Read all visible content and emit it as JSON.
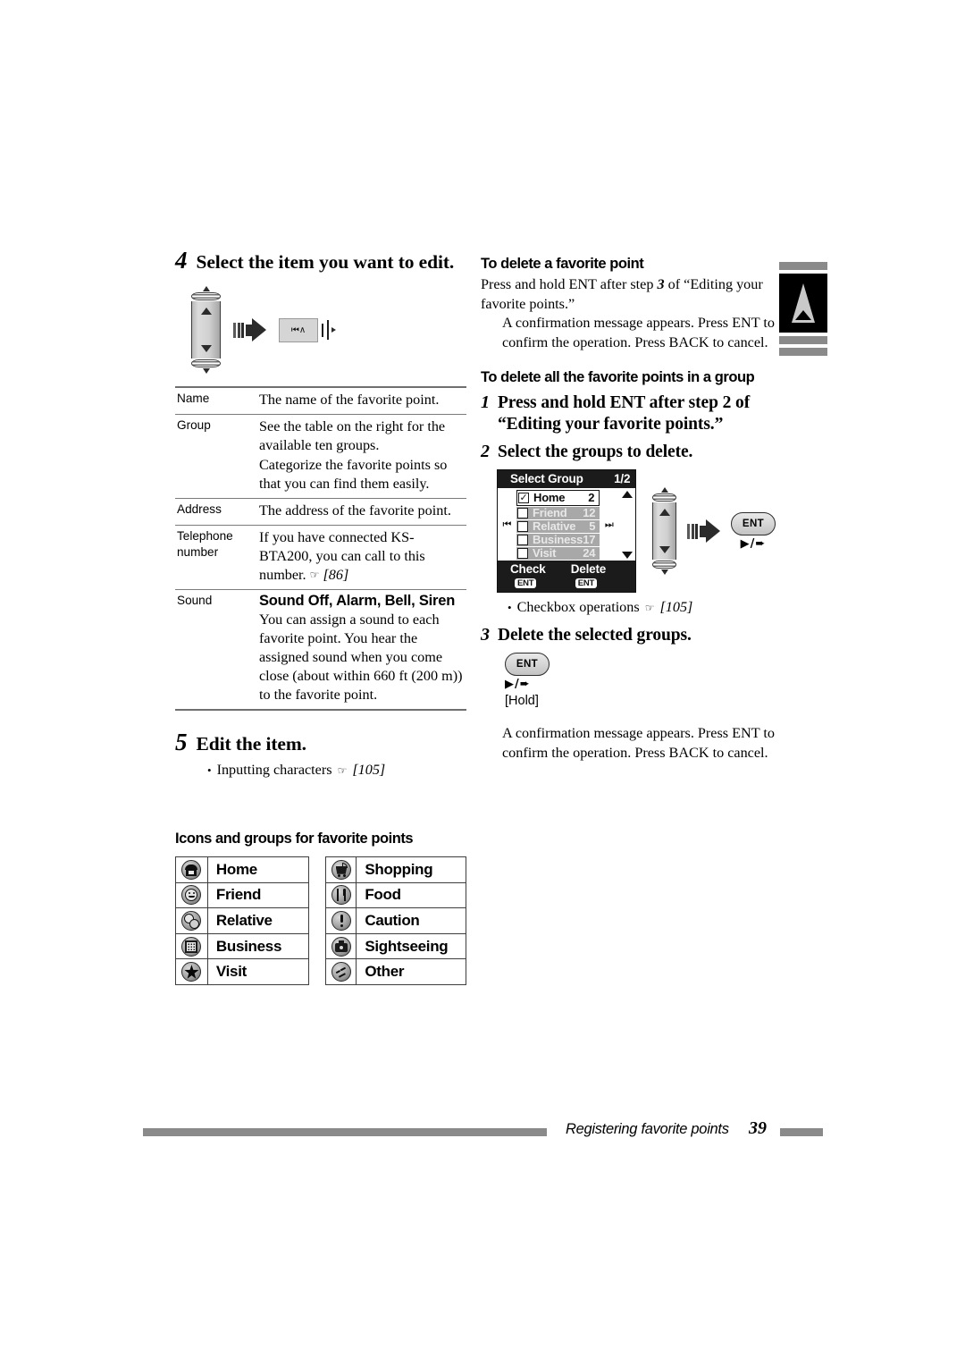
{
  "left": {
    "step4": {
      "num": "4",
      "title": "Select the item you want to edit."
    },
    "step5": {
      "num": "5",
      "title": "Edit the item."
    },
    "step5_bullet": {
      "text": "Inputting characters",
      "ref": "[105]"
    },
    "button_label": "⏮∧",
    "spec_table": {
      "rows": [
        {
          "key": "Name",
          "value": "The name of the favorite point.",
          "bold": ""
        },
        {
          "key": "Group",
          "value": "See the table on the right for the available ten groups.\nCategorize the favorite points so that you can find them easily.",
          "bold": ""
        },
        {
          "key": "Address",
          "value": "The address of the favorite point.",
          "bold": ""
        },
        {
          "key": "Telephone number",
          "value": "If you have connected KS-BTA200, you can call to this number.",
          "bold": "",
          "ref": "[86]"
        },
        {
          "key": "Sound",
          "bold": "Sound Off, Alarm, Bell, Siren",
          "value": "You can assign a sound to each favorite point. You hear the assigned sound when you come close (about within 660 ft (200 m)) to the favorite point."
        }
      ]
    },
    "icons_heading": "Icons and groups for favorite points",
    "icon_table_left": [
      {
        "label": "Home",
        "icon": "home-icon"
      },
      {
        "label": "Friend",
        "icon": "friend-icon"
      },
      {
        "label": "Relative",
        "icon": "relative-icon"
      },
      {
        "label": "Business",
        "icon": "business-icon"
      },
      {
        "label": "Visit",
        "icon": "visit-icon"
      }
    ],
    "icon_table_right": [
      {
        "label": "Shopping",
        "icon": "shopping-icon"
      },
      {
        "label": "Food",
        "icon": "food-icon"
      },
      {
        "label": "Caution",
        "icon": "caution-icon"
      },
      {
        "label": "Sightseeing",
        "icon": "sightseeing-icon"
      },
      {
        "label": "Other",
        "icon": "other-icon"
      }
    ]
  },
  "right": {
    "head1": "To delete a favorite point",
    "p1_a": "Press and hold ENT after step ",
    "p1_num": "3",
    "p1_b": " of “Editing your favorite points.”",
    "p1_indent": "A confirmation message appears. Press ENT to confirm the operation. Press BACK to cancel.",
    "head2": "To delete all the favorite points in a group",
    "step1": {
      "num": "1",
      "a": "Press and hold ENT after step ",
      "n": "2",
      "b": " of “Editing your favorite points.”"
    },
    "step2": {
      "num": "2",
      "title": "Select the groups to delete."
    },
    "step2_bullet": {
      "text": "Checkbox operations",
      "ref": "[105]"
    },
    "step3": {
      "num": "3",
      "title": "Delete the selected groups."
    },
    "ent_button": "ENT",
    "ent_sub": "▶/➨",
    "hold_label": "[Hold]",
    "p3_indent": "A confirmation message appears. Press ENT to confirm the operation. Press BACK to cancel."
  },
  "lcd": {
    "title": "Select Group",
    "page_indicator": "1/2",
    "prev_icon": "⏮",
    "next_icon": "⏭",
    "rows": [
      {
        "name": "Home",
        "count": "2",
        "checked": true,
        "selected": true
      },
      {
        "name": "Friend",
        "count": "12",
        "checked": false,
        "selected": false
      },
      {
        "name": "Relative",
        "count": "5",
        "checked": false,
        "selected": false
      },
      {
        "name": "Business",
        "count": "17",
        "checked": false,
        "selected": false
      },
      {
        "name": "Visit",
        "count": "24",
        "checked": false,
        "selected": false
      }
    ],
    "check_label": "Check",
    "check_chip": "ENT",
    "delete_label": "Delete",
    "delete_chip": "ENT",
    "side_ent_button": "ENT",
    "side_ent_sub": "▶/➨"
  },
  "footer": {
    "section": "Registering favorite points",
    "page": "39"
  },
  "colors": {
    "gray_bar": "#8a8a8a",
    "rule": "#7b7b7b",
    "lcd_bar": "#1b1b1b",
    "lcd_dim_row": "#a8a8a8"
  }
}
